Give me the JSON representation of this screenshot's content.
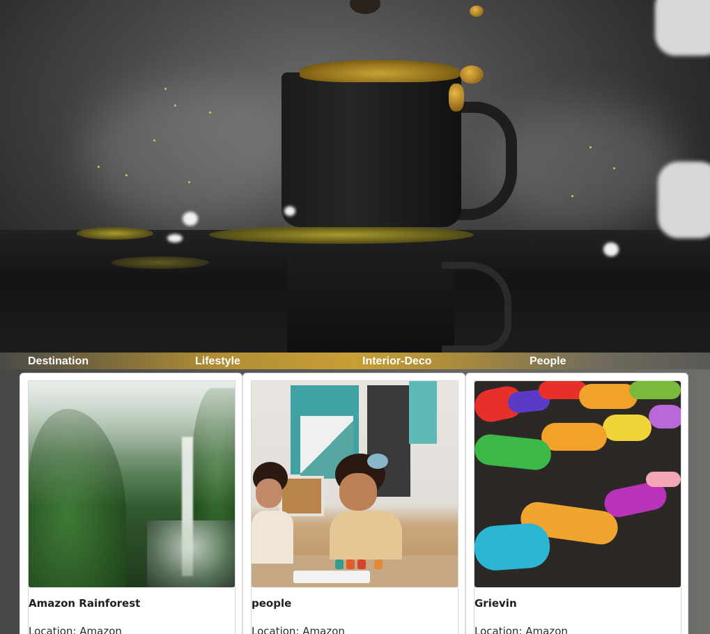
{
  "hero": {
    "image": "coffee-cup-splash-photo"
  },
  "categories": [
    {
      "label": "Destination"
    },
    {
      "label": "Lifestyle"
    },
    {
      "label": "Interior-Deco"
    },
    {
      "label": "People"
    }
  ],
  "cards": [
    {
      "title": "Amazon Rainforest",
      "location": "Location: Amazon",
      "image": "waterfall-forest-photo"
    },
    {
      "title": "people",
      "location": "Location: Amazon",
      "image": "children-painting-photo"
    },
    {
      "title": "Grievin",
      "location": "Location: Amazon",
      "image": "felt-letters-photo"
    }
  ],
  "colors": {
    "category_bar_accent": "#c89f36",
    "card_background": "#ffffff",
    "category_text": "#ffffff",
    "page_background": "#5a5955"
  }
}
